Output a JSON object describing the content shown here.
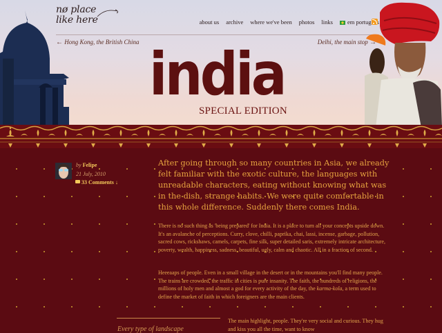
{
  "site": {
    "logo_line1": "nø place",
    "logo_line2": "like here"
  },
  "nav": {
    "items": [
      "about us",
      "archive",
      "where we've been",
      "photos",
      "links",
      "em português"
    ]
  },
  "post_nav": {
    "prev": "Hong Kong, the British China",
    "next": "Delhi, the main stop"
  },
  "title": {
    "word": "india",
    "subtitle": "SPECIAL EDITION"
  },
  "post": {
    "by_prefix": "by",
    "author": "Felipe",
    "date": "21 July, 2010",
    "comments": "33 Comments",
    "lead": "After going through so many countries in Asia, we already felt familiar with the exotic culture, the languages with unreadable characters, eating without knowing what was in the dish, strange habits. We were quite comfortable in this whole difference. Suddenly there comes India.",
    "p1": "There is no such thing as 'being prepared' for India. It is a place to turn all your concepts upside down. It's an avalanche of perceptions. Curry, clove, chilli, paprika, chai, lassi, incense, garbage, pollution, sacred cows, rickshaws, camels, carpets, fine silk, super detailed saris, extremely intricate architecture, poverty, wealth, happiness, sadness, beautiful, ugly, calm and chaotic. All in a fraction of second.",
    "p2_start": "Heeeaaps of people. Even in a small village in the desert or in the mountains you'll find many people. The trains are crowded, the traffic in cities is pure insanity. The faith, the hundreds of religions, the millions of holy men and almost a god for every activity of the day, the ",
    "p2_em": "karma-kola",
    "p2_end": ", a term used to define the market of faith in which foreigners are the main clients.",
    "p3": "The main highlight, people. They're very social and curious. They hug and kiss you all the time, want to know",
    "sidebar_caption": "Every type of landscape"
  },
  "colors": {
    "maroon": "#5b0b12",
    "gold": "#e6a33f",
    "title_red": "#5c1010"
  }
}
